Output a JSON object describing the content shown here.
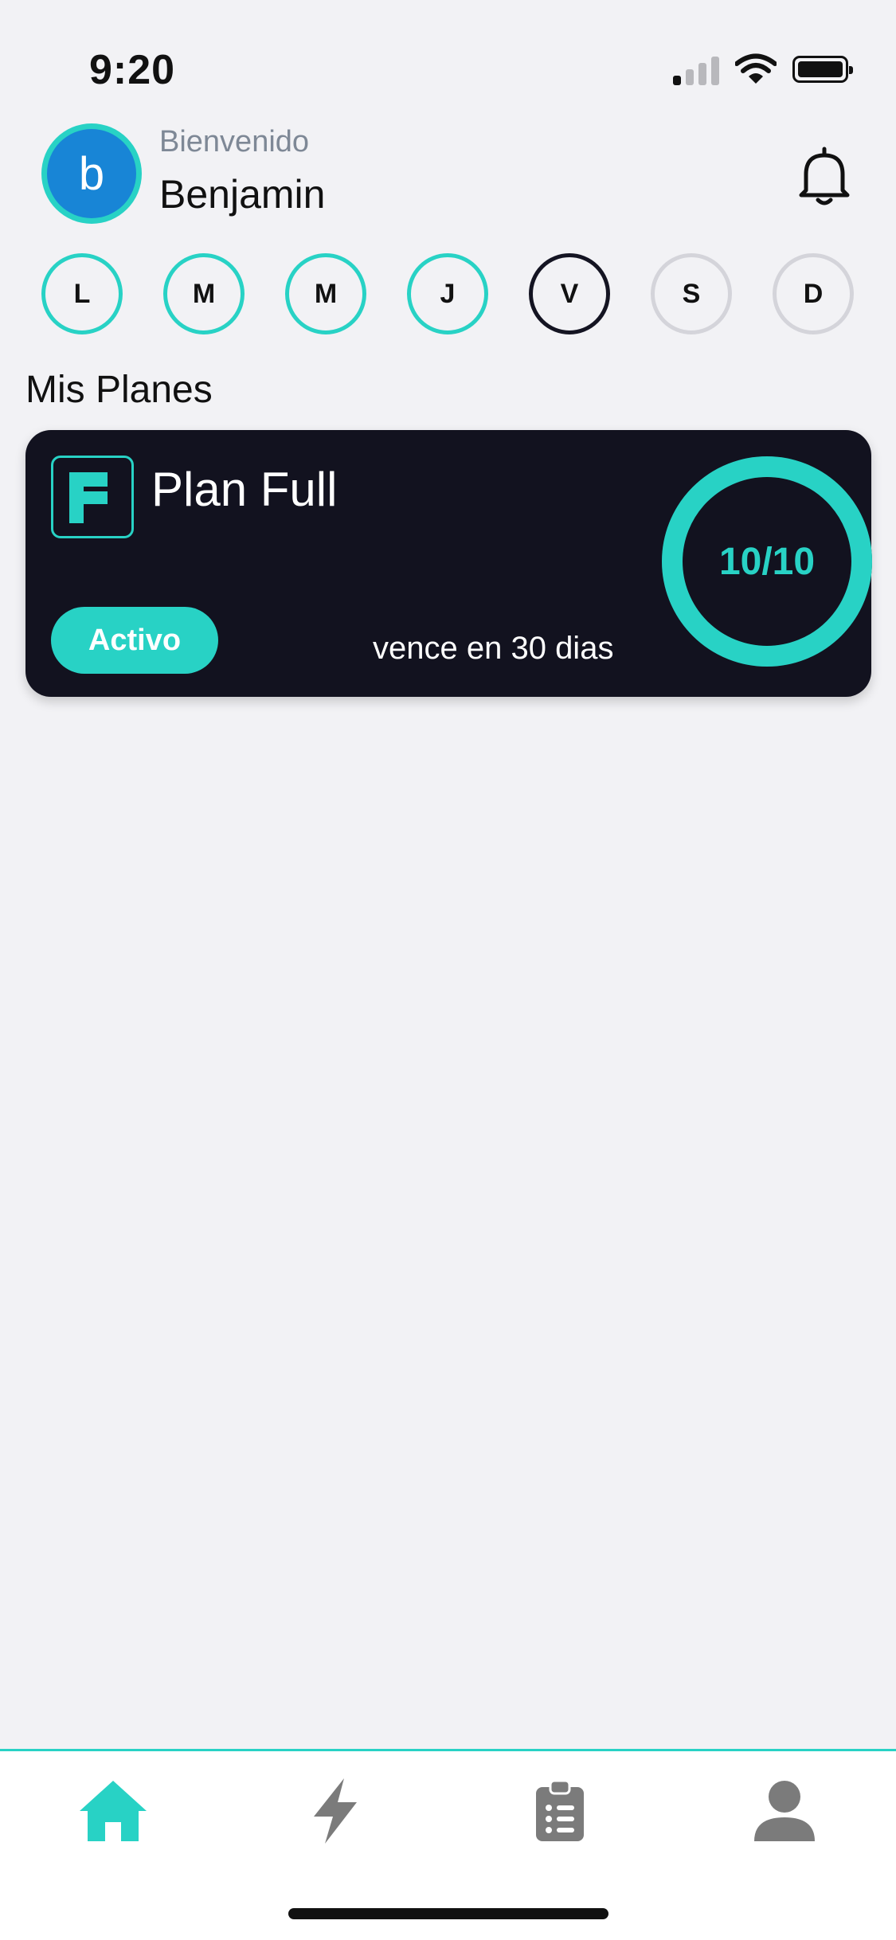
{
  "status_bar": {
    "time": "9:20",
    "icons": [
      "signal-icon",
      "wifi-icon",
      "battery-icon"
    ]
  },
  "header": {
    "avatar_initial": "b",
    "welcome": "Bienvenido",
    "user_name": "Benjamin",
    "notification_icon": "bell-icon"
  },
  "week": {
    "days": [
      {
        "label": "L",
        "state": "done"
      },
      {
        "label": "M",
        "state": "done"
      },
      {
        "label": "M",
        "state": "done"
      },
      {
        "label": "J",
        "state": "done"
      },
      {
        "label": "V",
        "state": "current"
      },
      {
        "label": "S",
        "state": "future"
      },
      {
        "label": "D",
        "state": "future"
      }
    ]
  },
  "plans": {
    "title": "Mis Planes",
    "items": [
      {
        "name": "Plan Full",
        "status": "Activo",
        "expires": "vence en 30 dias",
        "progress_label": "10/10",
        "progress_fraction": 1.0
      }
    ]
  },
  "tabbar": {
    "tabs": [
      {
        "icon": "home-icon",
        "active": true
      },
      {
        "icon": "lightning-icon",
        "active": false
      },
      {
        "icon": "clipboard-list-icon",
        "active": false
      },
      {
        "icon": "user-icon",
        "active": false
      }
    ]
  },
  "colors": {
    "accent": "#28d2c5",
    "card_bg": "#12121f",
    "avatar_bg": "#1885d6",
    "background": "#f2f2f5",
    "inactive_icon": "#7b7b7b"
  }
}
